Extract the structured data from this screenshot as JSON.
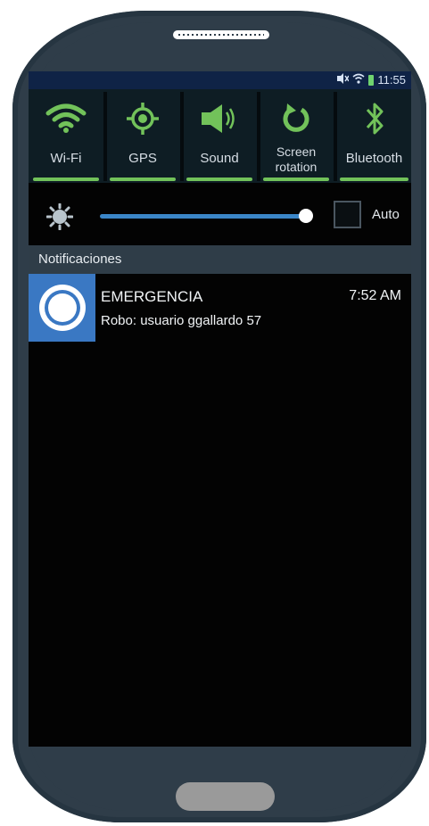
{
  "status_bar": {
    "time": "11:55",
    "icons": [
      "mute-icon",
      "wifi-icon",
      "battery-icon"
    ]
  },
  "quick_settings": [
    {
      "label": "Wi-Fi",
      "icon": "wifi-icon",
      "active": true
    },
    {
      "label": "GPS",
      "icon": "gps-icon",
      "active": true
    },
    {
      "label": "Sound",
      "icon": "sound-icon",
      "active": true
    },
    {
      "label": "Screen rotation",
      "line1": "Screen",
      "line2": "rotation",
      "icon": "rotation-icon",
      "active": true
    },
    {
      "label": "Bluetooth",
      "icon": "bluetooth-icon",
      "active": true
    }
  ],
  "brightness": {
    "icon": "brightness-icon",
    "level": 0.93,
    "auto_label": "Auto",
    "auto_checked": false
  },
  "notifications": {
    "header": "Notificaciones",
    "items": [
      {
        "title": "EMERGENCIA",
        "time": "7:52  AM",
        "text": "Robo: usuario ggallardo 57",
        "icon": "alert-ring-icon"
      }
    ]
  },
  "colors": {
    "accent": "#72c25a",
    "slider": "#3b86c8",
    "phone_body": "#2f3d49",
    "notif_icon_bg": "#3a78c3"
  }
}
